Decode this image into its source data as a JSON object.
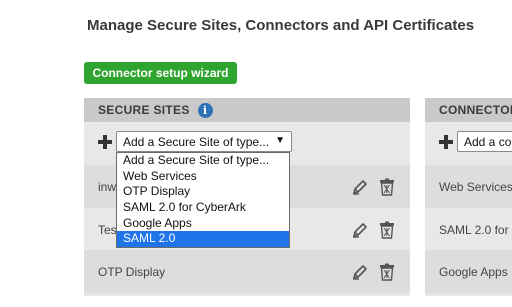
{
  "page": {
    "title": "Manage Secure Sites, Connectors and API Certificates"
  },
  "toolbar": {
    "wizard_label": "Connector setup wizard"
  },
  "secure_sites": {
    "header": "SECURE SITES",
    "info_icon": "i",
    "add_select": {
      "value": "Add a Secure Site of type...",
      "arrow": "▼"
    },
    "dropdown_options": [
      "Add a Secure Site of type...",
      "Web Services",
      "OTP Display",
      "SAML 2.0 for CyberArk",
      "Google Apps",
      "SAML 2.0"
    ],
    "selected_option": "SAML 2.0",
    "rows": [
      {
        "name": "inw"
      },
      {
        "name": "Tes"
      },
      {
        "name": "OTP Display"
      }
    ]
  },
  "connectors": {
    "header": "CONNECTOR",
    "add_select": {
      "value": "Add a co"
    },
    "rows": [
      {
        "name": "Web Services"
      },
      {
        "name": "SAML 2.0 for"
      },
      {
        "name": "Google Apps"
      }
    ]
  },
  "colors": {
    "wizard_green": "#2fa52f",
    "info_blue": "#2f72b8",
    "selected_blue": "#1e74e8",
    "panel_header": "#c9c9c9",
    "panel_body": "#e8e8e8"
  },
  "icons": [
    "plus-icon",
    "info-icon",
    "edit-pencil-icon",
    "trash-icon"
  ]
}
